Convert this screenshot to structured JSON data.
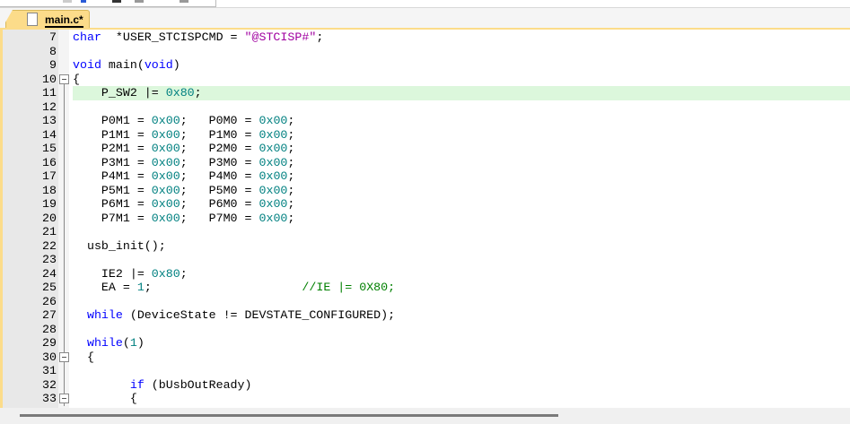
{
  "tab": {
    "label": "main.c*"
  },
  "colors": {
    "keyword": "#0000ff",
    "number": "#008080",
    "string": "#a000a0",
    "comment": "#008000",
    "current_line": "#dcf7dc",
    "tab": "#fcdc8a"
  },
  "lines": [
    {
      "n": "7",
      "t": [
        [
          "kw",
          "char"
        ],
        [
          "",
          "  *USER_STCISPCMD = "
        ],
        [
          "st",
          "\"@STCISP#\""
        ],
        [
          "",
          ";"
        ]
      ]
    },
    {
      "n": "8",
      "t": []
    },
    {
      "n": "9",
      "t": [
        [
          "kw",
          "void"
        ],
        [
          "",
          " main("
        ],
        [
          "kw",
          "void"
        ],
        [
          "",
          ")"
        ]
      ]
    },
    {
      "n": "10",
      "fold": true,
      "t": [
        [
          "",
          "{"
        ]
      ]
    },
    {
      "n": "11",
      "hl": true,
      "t": [
        [
          "",
          "    P_SW2 |= "
        ],
        [
          "nm",
          "0x80"
        ],
        [
          "",
          ";"
        ]
      ]
    },
    {
      "n": "12",
      "t": []
    },
    {
      "n": "13",
      "t": [
        [
          "",
          "    P0M1 = "
        ],
        [
          "nm",
          "0x00"
        ],
        [
          "",
          ";   P0M0 = "
        ],
        [
          "nm",
          "0x00"
        ],
        [
          "",
          ";"
        ]
      ]
    },
    {
      "n": "14",
      "t": [
        [
          "",
          "    P1M1 = "
        ],
        [
          "nm",
          "0x00"
        ],
        [
          "",
          ";   P1M0 = "
        ],
        [
          "nm",
          "0x00"
        ],
        [
          "",
          ";"
        ]
      ]
    },
    {
      "n": "15",
      "t": [
        [
          "",
          "    P2M1 = "
        ],
        [
          "nm",
          "0x00"
        ],
        [
          "",
          ";   P2M0 = "
        ],
        [
          "nm",
          "0x00"
        ],
        [
          "",
          ";"
        ]
      ]
    },
    {
      "n": "16",
      "t": [
        [
          "",
          "    P3M1 = "
        ],
        [
          "nm",
          "0x00"
        ],
        [
          "",
          ";   P3M0 = "
        ],
        [
          "nm",
          "0x00"
        ],
        [
          "",
          ";"
        ]
      ]
    },
    {
      "n": "17",
      "t": [
        [
          "",
          "    P4M1 = "
        ],
        [
          "nm",
          "0x00"
        ],
        [
          "",
          ";   P4M0 = "
        ],
        [
          "nm",
          "0x00"
        ],
        [
          "",
          ";"
        ]
      ]
    },
    {
      "n": "18",
      "t": [
        [
          "",
          "    P5M1 = "
        ],
        [
          "nm",
          "0x00"
        ],
        [
          "",
          ";   P5M0 = "
        ],
        [
          "nm",
          "0x00"
        ],
        [
          "",
          ";"
        ]
      ]
    },
    {
      "n": "19",
      "t": [
        [
          "",
          "    P6M1 = "
        ],
        [
          "nm",
          "0x00"
        ],
        [
          "",
          ";   P6M0 = "
        ],
        [
          "nm",
          "0x00"
        ],
        [
          "",
          ";"
        ]
      ]
    },
    {
      "n": "20",
      "t": [
        [
          "",
          "    P7M1 = "
        ],
        [
          "nm",
          "0x00"
        ],
        [
          "",
          ";   P7M0 = "
        ],
        [
          "nm",
          "0x00"
        ],
        [
          "",
          ";"
        ]
      ]
    },
    {
      "n": "21",
      "t": []
    },
    {
      "n": "22",
      "t": [
        [
          "",
          "  usb_init();"
        ]
      ]
    },
    {
      "n": "23",
      "t": []
    },
    {
      "n": "24",
      "t": [
        [
          "",
          "    IE2 |= "
        ],
        [
          "nm",
          "0x80"
        ],
        [
          "",
          ";"
        ]
      ]
    },
    {
      "n": "25",
      "t": [
        [
          "",
          "    EA = "
        ],
        [
          "nm",
          "1"
        ],
        [
          "",
          ";                     "
        ],
        [
          "cm",
          "//IE |= 0X80;"
        ]
      ]
    },
    {
      "n": "26",
      "t": []
    },
    {
      "n": "27",
      "t": [
        [
          "kw",
          "  while"
        ],
        [
          "",
          " (DeviceState != DEVSTATE_CONFIGURED);"
        ]
      ]
    },
    {
      "n": "28",
      "t": []
    },
    {
      "n": "29",
      "t": [
        [
          "kw",
          "  while"
        ],
        [
          "",
          "("
        ],
        [
          "nm",
          "1"
        ],
        [
          "",
          ")"
        ]
      ]
    },
    {
      "n": "30",
      "fold": true,
      "t": [
        [
          "",
          "  {"
        ]
      ]
    },
    {
      "n": "31",
      "t": []
    },
    {
      "n": "32",
      "t": [
        [
          "kw",
          "        if"
        ],
        [
          "",
          " (bUsbOutReady)"
        ]
      ]
    },
    {
      "n": "33",
      "fold": true,
      "t": [
        [
          "",
          "        {"
        ]
      ]
    }
  ]
}
